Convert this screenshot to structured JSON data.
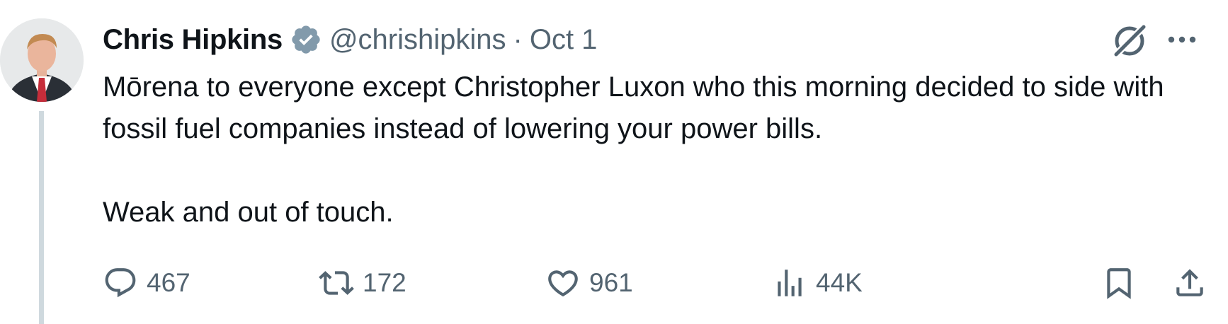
{
  "tweet": {
    "author_name": "Chris Hipkins",
    "handle": "@chrishipkins",
    "separator": "·",
    "date": "Oct 1",
    "verified": true,
    "text_line_1": "Mōrena to everyone except Christopher Luxon who this morning decided to side with fossil fuel companies instead of lowering your power bills.",
    "text_line_2": "Weak and out of touch."
  },
  "actions": {
    "replies": "467",
    "reposts": "172",
    "likes": "961",
    "views": "44K"
  },
  "icons": {
    "verified": "verified-badge-icon",
    "grok": "grok-icon",
    "more": "more-icon",
    "reply": "reply-icon",
    "repost": "repost-icon",
    "like": "heart-icon",
    "views": "views-icon",
    "bookmark": "bookmark-icon",
    "share": "share-icon"
  },
  "colors": {
    "text": "#0f1419",
    "muted": "#536471",
    "thread_line": "#cfd9de",
    "verified_badge": "#829aab"
  }
}
